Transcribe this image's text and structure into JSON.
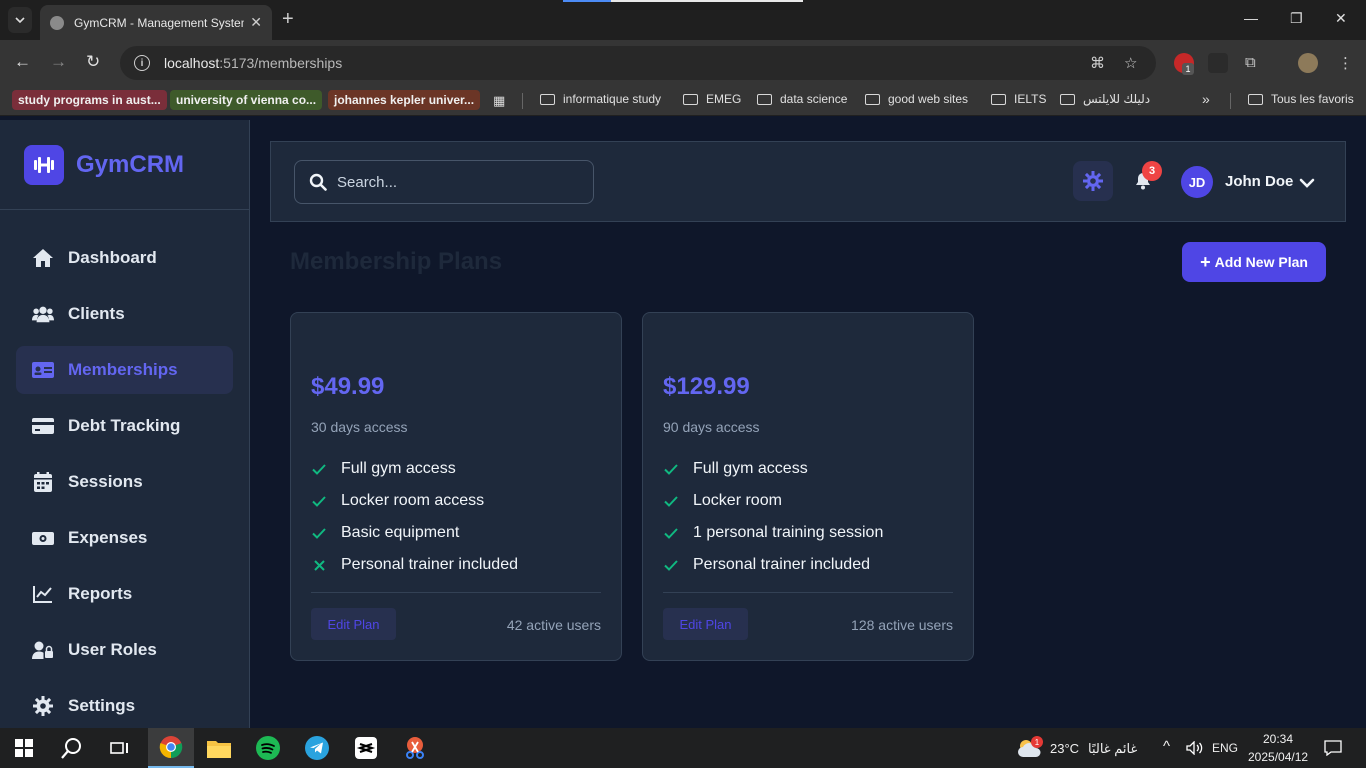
{
  "browser": {
    "tab_title": "GymCRM - Management System",
    "url_host": "localhost",
    "url_rest": ":5173/memberships",
    "bookmarks": [
      {
        "label": "study programs in aust...",
        "color": "#7a2e3a"
      },
      {
        "label": "university of vienna co...",
        "color": "#3e5a2a"
      },
      {
        "label": "johannes kepler univer...",
        "color": "#6b3526"
      }
    ],
    "folders": [
      "informatique study",
      "EMEG",
      "data science",
      "good web sites",
      "IELTS",
      "دليلك للايلتس"
    ],
    "all_bookmarks": "Tous les favoris",
    "extension_badge": "1"
  },
  "app": {
    "brand": "GymCRM",
    "nav": [
      {
        "label": "Dashboard",
        "icon": "home-icon"
      },
      {
        "label": "Clients",
        "icon": "users-icon"
      },
      {
        "label": "Memberships",
        "icon": "id-card-icon",
        "active": true
      },
      {
        "label": "Debt Tracking",
        "icon": "credit-card-icon"
      },
      {
        "label": "Sessions",
        "icon": "calendar-icon"
      },
      {
        "label": "Expenses",
        "icon": "money-icon"
      },
      {
        "label": "Reports",
        "icon": "chart-line-icon"
      },
      {
        "label": "User Roles",
        "icon": "user-lock-icon"
      },
      {
        "label": "Settings",
        "icon": "gear-icon"
      }
    ],
    "search_placeholder": "Search...",
    "notification_count": "3",
    "user_initials": "JD",
    "user_name": "John Doe",
    "page_title": "Membership Plans",
    "add_button": "Add New Plan",
    "plans": [
      {
        "price": "$49.99",
        "duration": "30 days access",
        "features": [
          {
            "text": "Full gym access",
            "included": true
          },
          {
            "text": "Locker room access",
            "included": true
          },
          {
            "text": "Basic equipment",
            "included": true
          },
          {
            "text": "Personal trainer included",
            "included": false
          }
        ],
        "edit_label": "Edit Plan",
        "active_users": "42 active users"
      },
      {
        "price": "$129.99",
        "duration": "90 days access",
        "features": [
          {
            "text": "Full gym access",
            "included": true
          },
          {
            "text": "Locker room",
            "included": true
          },
          {
            "text": "1 personal training session",
            "included": true
          },
          {
            "text": "Personal trainer included",
            "included": true
          }
        ],
        "edit_label": "Edit Plan",
        "active_users": "128 active users"
      }
    ]
  },
  "colors": {
    "accent": "#6366f1",
    "accent_dark": "#4f46e5",
    "check": "#10b981",
    "sidebar": "#1e293b",
    "background": "#0f172a",
    "badge": "#ef4444"
  },
  "taskbar": {
    "temperature": "23°C",
    "weather_text": "غائم غالبًا",
    "weather_badge": "1",
    "language": "ENG",
    "time": "20:34",
    "date": "2025/04/12"
  }
}
